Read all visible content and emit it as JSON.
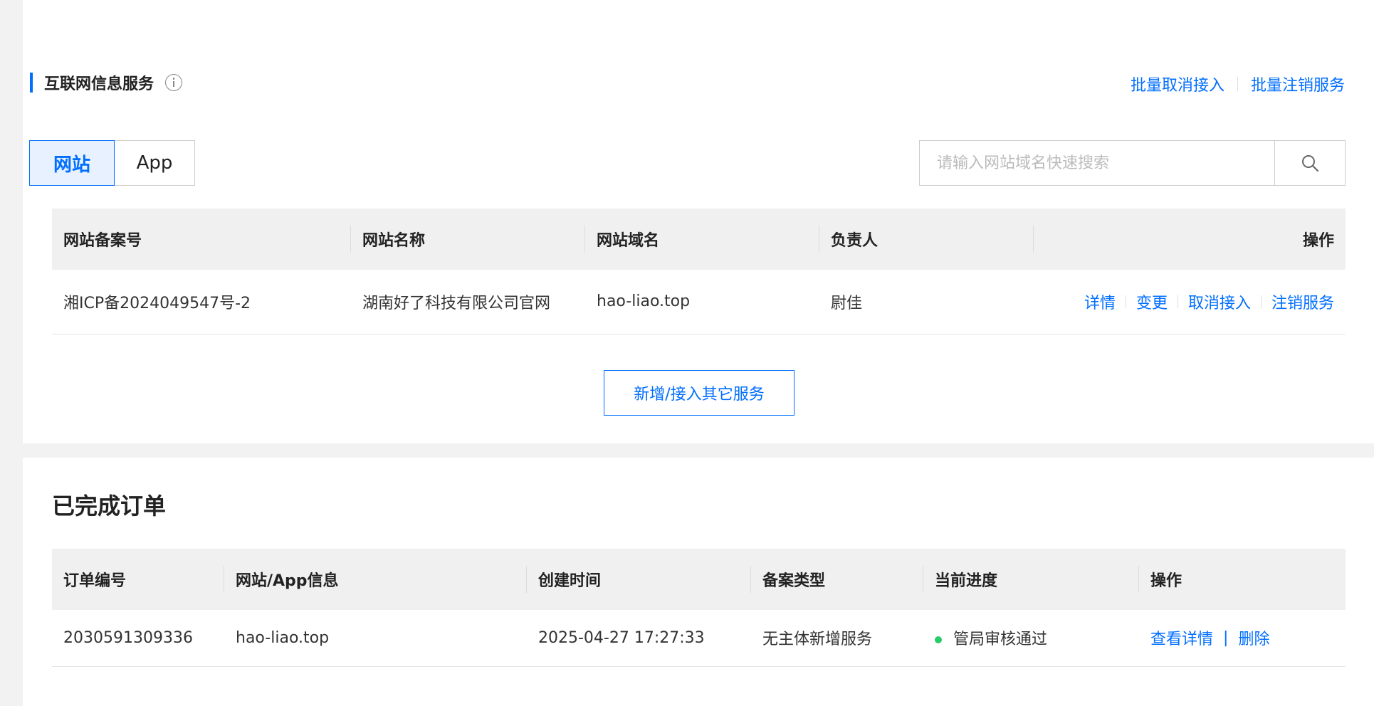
{
  "section": {
    "title": "互联网信息服务",
    "batch_cancel": "批量取消接入",
    "batch_revoke": "批量注销服务"
  },
  "tabs": {
    "website": "网站",
    "app": "App",
    "active": "website"
  },
  "search": {
    "placeholder": "请输入网站域名快速搜索",
    "value": ""
  },
  "sites_table": {
    "headers": [
      "网站备案号",
      "网站名称",
      "网站域名",
      "负责人",
      "操作"
    ],
    "rows": [
      {
        "icp": "湘ICP备2024049547号-2",
        "name": "湖南好了科技有限公司官网",
        "domain": "hao-liao.top",
        "owner": "尉佳",
        "actions": {
          "detail": "详情",
          "change": "变更",
          "cancel": "取消接入",
          "revoke": "注销服务"
        }
      }
    ]
  },
  "add_service_button": "新增/接入其它服务",
  "orders": {
    "title": "已完成订单",
    "headers": [
      "订单编号",
      "网站/App信息",
      "创建时间",
      "备案类型",
      "当前进度",
      "操作"
    ],
    "rows": [
      {
        "order_no": "2030591309336",
        "info": "hao-liao.top",
        "created": "2025-04-27 17:27:33",
        "type": "无主体新增服务",
        "status": "管局审核通过",
        "actions": {
          "view": "查看详情",
          "sep": "|",
          "delete": "删除"
        }
      }
    ]
  },
  "colors": {
    "accent": "#006eff",
    "status_ok": "#29cc6a"
  },
  "icons": {
    "info": "info-circle-icon",
    "search": "search-icon"
  }
}
